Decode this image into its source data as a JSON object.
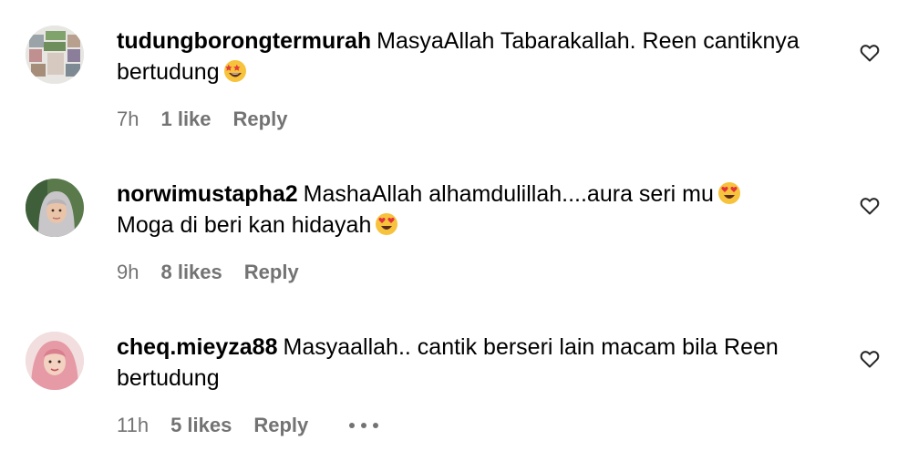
{
  "comments": [
    {
      "username": "tudungborongtermurah",
      "text": "MasyaAllah Tabarakallah. Reen cantiknya bertudung",
      "emoji": "star-struck-emoji",
      "time": "7h",
      "likes": "1 like",
      "reply": "Reply",
      "avatar": "product-grid-avatar"
    },
    {
      "username": "norwimustapha2",
      "text_line1": "MashaAllah alhamdulillah....aura seri mu",
      "text_line2": "Moga di beri kan hidayah",
      "emoji": "heart-eyes-emoji",
      "time": "9h",
      "likes": "8 likes",
      "reply": "Reply",
      "avatar": "hijab-woman-avatar"
    },
    {
      "username": "cheq.mieyza88",
      "text": "Masyaallah.. cantik berseri lain macam bila Reen bertudung",
      "time": "11h",
      "likes": "5 likes",
      "reply": "Reply",
      "more": "more-options-icon",
      "avatar": "pink-hijab-avatar"
    }
  ],
  "icons": {
    "like": "heart-outline-icon"
  },
  "colors": {
    "text": "#000000",
    "meta": "#737373",
    "background": "#ffffff"
  }
}
